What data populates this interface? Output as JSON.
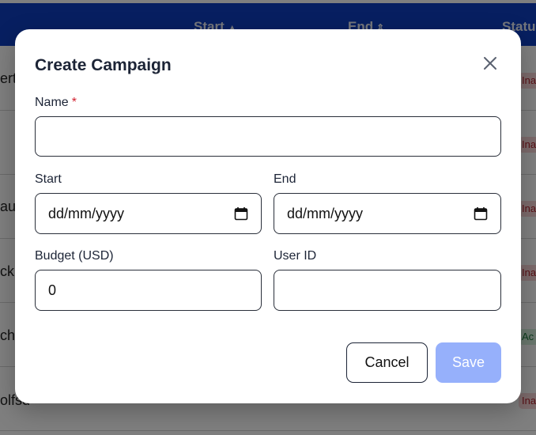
{
  "table": {
    "headers": {
      "start": "Start",
      "start_icon": "▲",
      "end": "End",
      "end_icon": "⇕",
      "status": "Statu"
    },
    "rows": [
      {
        "name_fragment": "ert",
        "status": "Ina",
        "status_kind": "inactive"
      },
      {
        "name_fragment": "",
        "status": "Ina",
        "status_kind": "inactive"
      },
      {
        "name_fragment": "auc",
        "status": "Ina",
        "status_kind": "inactive"
      },
      {
        "name_fragment": "ck",
        "status": "Ina",
        "status_kind": "inactive"
      },
      {
        "name_fragment": "ch",
        "status": "Ac",
        "status_kind": "active"
      },
      {
        "name_fragment": "olfsd",
        "status": "Ina",
        "status_kind": "inactive"
      }
    ]
  },
  "modal": {
    "title": "Create Campaign",
    "close_icon": "close-icon",
    "fields": {
      "name": {
        "label": "Name",
        "required_mark": "*",
        "value": ""
      },
      "start": {
        "label": "Start",
        "placeholder": "dd/mm/yyyy",
        "icon": "calendar-icon"
      },
      "end": {
        "label": "End",
        "placeholder": "dd/mm/yyyy",
        "icon": "calendar-icon"
      },
      "budget": {
        "label": "Budget (USD)",
        "value": "0"
      },
      "user_id": {
        "label": "User ID",
        "value": ""
      }
    },
    "buttons": {
      "cancel": "Cancel",
      "save": "Save"
    }
  },
  "colors": {
    "header_bg": "#0f3fc2",
    "save_disabled": "#96b0fb",
    "required": "#d11f2e"
  }
}
